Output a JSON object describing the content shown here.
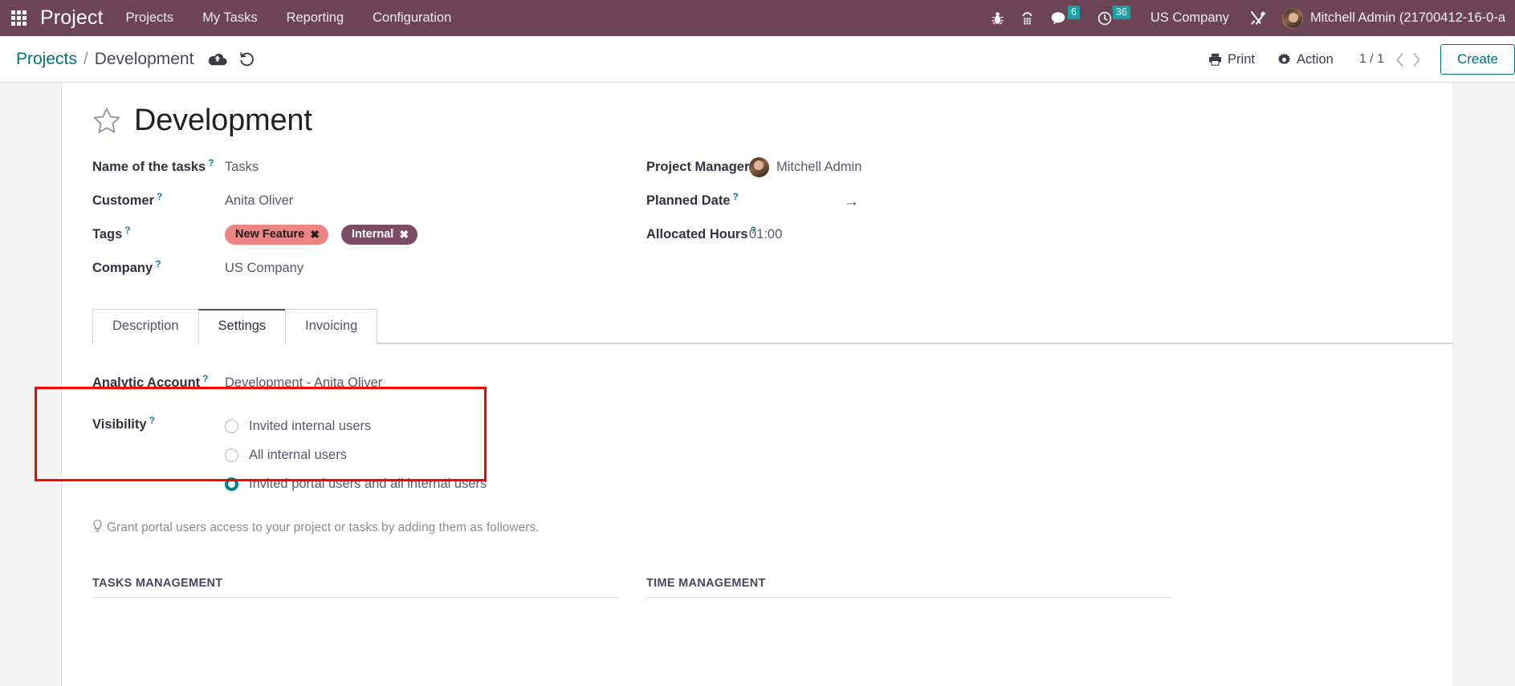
{
  "navbar": {
    "apps_icon": "apps-grid-icon",
    "brand": "Project",
    "menus": [
      {
        "label": "Projects"
      },
      {
        "label": "My Tasks"
      },
      {
        "label": "Reporting"
      },
      {
        "label": "Configuration"
      }
    ],
    "sys_icons": [
      {
        "name": "bug-icon"
      },
      {
        "name": "phone-keypad-icon"
      },
      {
        "name": "messages-icon",
        "badge": "6"
      },
      {
        "name": "activities-clock-icon",
        "badge": "36"
      }
    ],
    "company": "US Company",
    "tools_icon": "tools-icon",
    "user": "Mitchell Admin (21700412-16-0-a",
    "bg_color": "#6b4556",
    "badge_color": "#17a2a8"
  },
  "control_panel": {
    "breadcrumb": {
      "root": "Projects",
      "separator": "/",
      "current": "Development"
    },
    "save_icon": "cloud-upload-save-icon",
    "discard_icon": "undo-discard-icon",
    "print_label": "Print",
    "action_label": "Action",
    "pager": "1 / 1",
    "prev_icon": "chevron-left-icon",
    "next_icon": "chevron-right-icon",
    "create_label": "Create",
    "accent_color": "#00707f"
  },
  "form": {
    "favorite_icon": "star-outline-icon",
    "title": "Development",
    "left_fields": [
      {
        "label": "Name of the tasks",
        "help": "?",
        "value": "Tasks",
        "type": "text"
      },
      {
        "label": "Customer",
        "help": "?",
        "value": "Anita Oliver",
        "type": "text"
      },
      {
        "label": "Tags",
        "help": "?",
        "type": "tags"
      },
      {
        "label": "Company",
        "help": "?",
        "value": "US Company",
        "type": "text"
      }
    ],
    "tags": [
      {
        "label": "New Feature",
        "bg": "#ec8484",
        "fg": "#1f1f1f",
        "remove_icon": "close-icon"
      },
      {
        "label": "Internal",
        "bg": "#7c4b66",
        "fg": "#ffffff",
        "remove_icon": "close-icon"
      }
    ],
    "right_fields": [
      {
        "label": "Project Manager",
        "help": "?",
        "value": "Mitchell Admin",
        "type": "user"
      },
      {
        "label": "Planned Date",
        "help": "?",
        "value": "",
        "type": "daterange",
        "arrow": "→"
      },
      {
        "label": "Allocated Hours",
        "help": "?",
        "value": "01:00",
        "type": "text"
      }
    ],
    "tabs": [
      {
        "label": "Description",
        "active": false
      },
      {
        "label": "Settings",
        "active": true
      },
      {
        "label": "Invoicing",
        "active": false
      }
    ],
    "settings": {
      "analytic_account": {
        "label": "Analytic Account",
        "help": "?",
        "value": "Development - Anita Oliver"
      },
      "visibility": {
        "label": "Visibility",
        "help": "?",
        "options": [
          {
            "label": "Invited internal users",
            "checked": false
          },
          {
            "label": "All internal users",
            "checked": false
          },
          {
            "label": "Invited portal users and all internal users",
            "checked": true
          }
        ],
        "checked_color": "#00838f"
      },
      "hint_icon": "lightbulb-icon",
      "hint": "Grant portal users access to your project or tasks by adding them as followers.",
      "sections": [
        {
          "title": "TASKS MANAGEMENT"
        },
        {
          "title": "TIME MANAGEMENT"
        }
      ]
    },
    "highlight": {
      "name": "visibility-highlight-box",
      "color": "#ff0000"
    }
  }
}
